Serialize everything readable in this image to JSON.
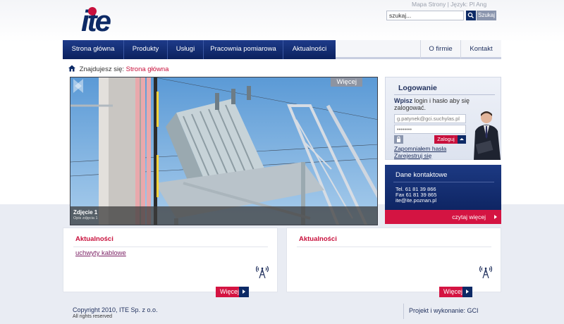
{
  "header": {
    "logo_text": "ite",
    "top_links": {
      "sitemap": "Mapa Strony",
      "separator": "|",
      "language_label": "Język:",
      "lang_pl": "Pl",
      "lang_en": "Ang"
    },
    "search": {
      "value": "szukaj...",
      "button": "Szukaj"
    }
  },
  "nav": {
    "left": [
      {
        "label": "Strona główna"
      },
      {
        "label": "Produkty"
      },
      {
        "label": "Usługi"
      },
      {
        "label": "Pracownia pomiarowa"
      },
      {
        "label": "Aktualności"
      }
    ],
    "right": [
      {
        "label": "O firmie"
      },
      {
        "label": "Kontakt"
      }
    ]
  },
  "breadcrumb": {
    "prefix": "Znajdujesz się:",
    "current": "Strona główna"
  },
  "slider": {
    "more": "Więcej",
    "caption_title": "Zdjęcie 1",
    "caption_sub": "Opis zdjęcia 1"
  },
  "login": {
    "title": "Logowanie",
    "desc_bold": "Wpisz",
    "desc_rest": " login i hasło aby się zalogować.",
    "login_value": "g.patynek@gci.suchylas.pl",
    "password_value": "••••••••",
    "button": "Zaloguj",
    "forgot": "Zapomniałem hasła",
    "register": "Zarejestruj się"
  },
  "contact": {
    "title": "Dane kontaktowe",
    "tel": "Tel. 61 81 39 866",
    "fax": "Fax 61 81 39 865",
    "email": "ite@ite.poznan.pl",
    "more": "czytaj więcej"
  },
  "news_left": {
    "title": "Aktualności",
    "item": "uchwyty kablowe",
    "more": "Więcej"
  },
  "news_right": {
    "title": "Aktualności",
    "more": "Więcej"
  },
  "footer": {
    "copyright": "Copyright 2010, ITE Sp. z o.o.",
    "rights": "All rights reserved",
    "credit": "Projekt i wykonanie: GCI"
  },
  "colors": {
    "navy": "#0d2a66",
    "accent_red": "#c8103c",
    "nav_blue": "#1e3b8a"
  }
}
